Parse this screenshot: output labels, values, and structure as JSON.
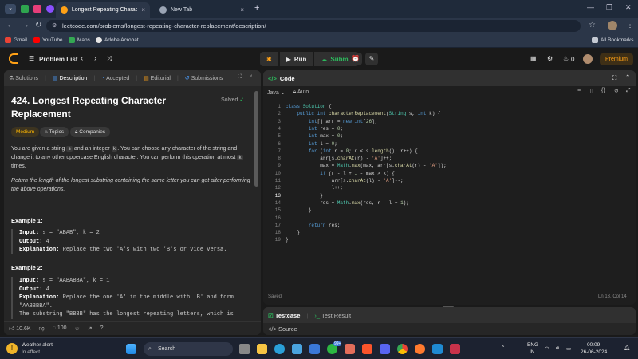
{
  "browser": {
    "tabs": [
      {
        "title": "Longest Repeating Character R",
        "close": "×"
      },
      {
        "title": "New Tab",
        "close": "×"
      }
    ],
    "new_tab": "+",
    "url": "leetcode.com/problems/longest-repeating-character-replacement/description/",
    "bookmarks": [
      "Gmail",
      "YouTube",
      "Maps",
      "Adobe Acrobat"
    ],
    "all_bookmarks": "All Bookmarks"
  },
  "lcnav": {
    "problem_list": "Problem List",
    "run": "Run",
    "submit": "Submit",
    "streak": "0",
    "premium": "Premium"
  },
  "left": {
    "tabs": [
      "Solutions",
      "Description",
      "Accepted",
      "Editorial",
      "Submissions"
    ],
    "title": "424. Longest Repeating Character Replacement",
    "solved": "Solved",
    "pills": [
      "Medium",
      "Topics",
      "Companies"
    ],
    "desc_1a": "You are given a string ",
    "desc_1b": "s",
    "desc_1c": " and an integer ",
    "desc_1d": "k",
    "desc_1e": ". You can choose any character of the string and change it to any other uppercase English character. You can perform this operation at most ",
    "desc_1f": "k",
    "desc_1g": " times.",
    "desc_2": "Return the length of the longest substring containing the same letter you can get after performing the above operations.",
    "example1": {
      "head": "Example 1:",
      "input_label": "Input:",
      "input": " s = \"ABAB\", k = 2",
      "output_label": "Output:",
      "output": " 4",
      "expl_label": "Explanation:",
      "expl": " Replace the two 'A's with two 'B's or vice versa."
    },
    "example2": {
      "head": "Example 2:",
      "input_label": "Input:",
      "input": " s = \"AABABBA\", k = 1",
      "output_label": "Output:",
      "output": " 4",
      "expl_label": "Explanation:",
      "expl": " Replace the one 'A' in the middle with 'B' and form \"AABBBBA\".",
      "expl2": "The substring \"BBBB\" has the longest repeating letters, which is"
    },
    "likes": "10.6K",
    "comments": "100"
  },
  "right": {
    "code_title": "Code",
    "language": "Java",
    "auto": "Auto",
    "code_lines": [
      "class Solution {",
      "    public int characterReplacement(String s, int k) {",
      "        int[] arr = new int[26];",
      "        int res = 0;",
      "        int max = 0;",
      "        int l = 0;",
      "        for (int r = 0; r < s.length(); r++) {",
      "            arr[s.charAt(r) - 'A']++;",
      "            max = Math.max(max, arr[s.charAt(r) - 'A']);",
      "            if (r - l + 1 - max > k) {",
      "                arr[s.charAt(l) - 'A']--;",
      "                l++;",
      "            }",
      "            res = Math.max(res, r - l + 1);",
      "        }",
      "",
      "        return res;",
      "    }",
      "}"
    ],
    "current_line": 13,
    "saved": "Saved",
    "cursor": "Ln 13, Col 14",
    "test_tabs": [
      "Testcase",
      "Test Result"
    ],
    "source": "Source"
  },
  "taskbar": {
    "weather_title": "Weather alert",
    "weather_sub": "In effect",
    "search": "Search",
    "lang": "ENG",
    "region": "IN",
    "time": "00:09",
    "date": "26-06-2024",
    "badge": "99+"
  },
  "colors": {
    "accent": "#ffa116",
    "run_green": "#2cbb5d",
    "medium": "#ffb800"
  }
}
